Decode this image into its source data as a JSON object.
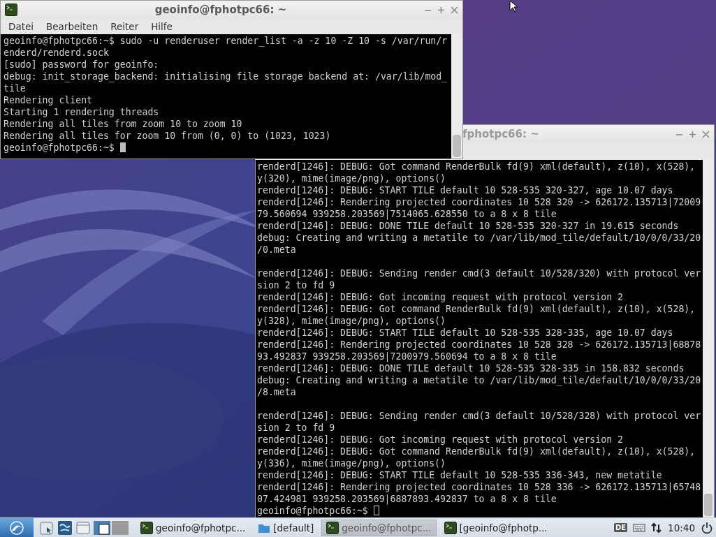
{
  "windows": [
    {
      "title": "geoinfo@fphotpc66: ~",
      "focused": true,
      "menu": [
        "Datei",
        "Bearbeiten",
        "Reiter",
        "Hilfe"
      ],
      "blocks": [
        [
          "geoinfo@fphotpc66:~$ sudo -u renderuser render_list -a -z 10 -Z 10 -s /var/run/r",
          "enderd/renderd.sock",
          "[sudo] password for geoinfo:",
          "debug: init_storage_backend: initialising file storage backend at: /var/lib/mod_",
          "tile",
          "Rendering client",
          "Starting 1 rendering threads",
          "Rendering all tiles from zoom 10 to zoom 10",
          "Rendering all tiles for zoom 10 from (0, 0) to (1023, 1023)",
          "geoinfo@fphotpc66:~$"
        ]
      ]
    },
    {
      "title": "fphotpc66: ~",
      "focused": false,
      "blocks": [
        [
          "renderd[1246]: DEBUG: Got command RenderBulk fd(9) xml(default), z(10), x(528),",
          "y(320), mime(image/png), options()",
          "renderd[1246]: DEBUG: START TILE default 10 528-535 320-327, age 10.07 days",
          "renderd[1246]: Rendering projected coordinates 10 528 320 -> 626172.135713|72009",
          "79.560694 939258.203569|7514065.628550 to a 8 x 8 tile",
          "renderd[1246]: DEBUG: DONE TILE default 10 528-535 320-327 in 19.615 seconds",
          "debug: Creating and writing a metatile to /var/lib/mod_tile/default/10/0/0/33/20",
          "/0.meta"
        ],
        [
          "renderd[1246]: DEBUG: Sending render cmd(3 default 10/528/320) with protocol ver",
          "sion 2 to fd 9",
          "renderd[1246]: DEBUG: Got incoming request with protocol version 2",
          "renderd[1246]: DEBUG: Got command RenderBulk fd(9) xml(default), z(10), x(528),",
          "y(328), mime(image/png), options()",
          "renderd[1246]: DEBUG: START TILE default 10 528-535 328-335, age 10.07 days",
          "renderd[1246]: Rendering projected coordinates 10 528 328 -> 626172.135713|68878",
          "93.492837 939258.203569|7200979.560694 to a 8 x 8 tile",
          "renderd[1246]: DEBUG: DONE TILE default 10 528-535 328-335 in 158.832 seconds",
          "debug: Creating and writing a metatile to /var/lib/mod_tile/default/10/0/0/33/20",
          "/8.meta"
        ],
        [
          "renderd[1246]: DEBUG: Sending render cmd(3 default 10/528/328) with protocol ver",
          "sion 2 to fd 9",
          "renderd[1246]: DEBUG: Got incoming request with protocol version 2",
          "renderd[1246]: DEBUG: Got command RenderBulk fd(9) xml(default), z(10), x(528),",
          "y(336), mime(image/png), options()",
          "renderd[1246]: DEBUG: START TILE default 10 528-535 336-343, new metatile",
          "renderd[1246]: Rendering projected coordinates 10 528 336 -> 626172.135713|65748",
          "07.424981 939258.203569|6887893.492837 to a 8 x 8 tile",
          "geoinfo@fphotpc66:~$"
        ]
      ]
    }
  ],
  "taskbar": {
    "tasks": [
      {
        "kind": "terminal",
        "label": "geoinfo@fphotpc...",
        "selected": false
      },
      {
        "kind": "folder",
        "label": "[default]",
        "selected": false
      },
      {
        "kind": "terminal",
        "label": "geoinfo@fphotpc...",
        "selected": true
      },
      {
        "kind": "terminal",
        "label": "[geoinfo@fphotp...",
        "selected": false
      }
    ],
    "keyboard_layout": "DE",
    "clock": "10:40"
  }
}
